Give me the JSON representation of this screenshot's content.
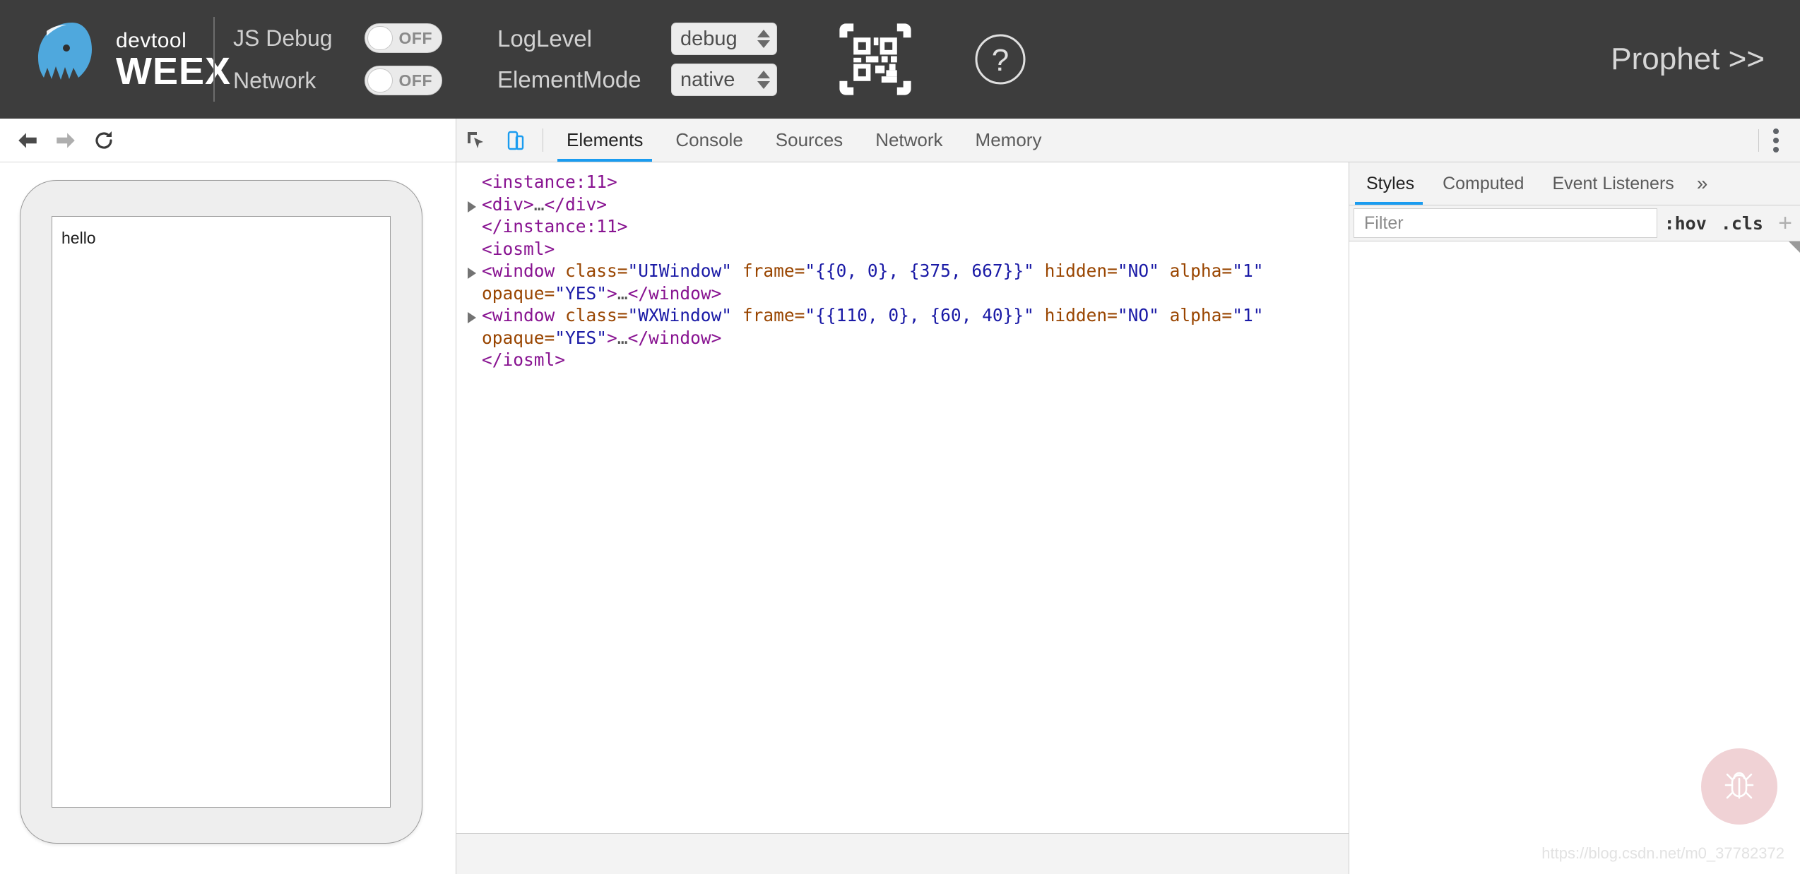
{
  "header": {
    "brand": {
      "devtool": "devtool",
      "weex": "WEEX",
      "logo_icon": "weex-bird-logo-icon"
    },
    "toggles": [
      {
        "label": "JS Debug",
        "state": "OFF",
        "on": false
      },
      {
        "label": "Network",
        "state": "OFF",
        "on": false
      }
    ],
    "selects": [
      {
        "label": "LogLevel",
        "value": "debug"
      },
      {
        "label": "ElementMode",
        "value": "native"
      }
    ],
    "qr_icon": "qr-scan-icon",
    "help_icon": "help-question-icon",
    "prophet_link": "Prophet >>",
    "brand_color": "#4fa8dd",
    "bg_color": "#3d3d3d"
  },
  "preview": {
    "nav": {
      "back_icon": "arrow-back-icon",
      "forward_icon": "arrow-forward-icon",
      "reload_icon": "reload-icon"
    },
    "device_screen_text": "hello"
  },
  "devtools": {
    "toolbar": {
      "inspect_icon": "inspect-cursor-icon",
      "device_icon": "device-toolbar-icon",
      "menu_icon": "kebab-menu-icon",
      "tabs": [
        {
          "label": "Elements",
          "active": true
        },
        {
          "label": "Console",
          "active": false
        },
        {
          "label": "Sources",
          "active": false
        },
        {
          "label": "Network",
          "active": false
        },
        {
          "label": "Memory",
          "active": false
        }
      ],
      "active_tab_color": "#1a9cf0"
    },
    "dom_tree": {
      "lines": [
        {
          "indent": 0,
          "arrow": false,
          "parts": [
            {
              "t": "tag",
              "v": "<instance:11>"
            }
          ]
        },
        {
          "indent": 0,
          "arrow": true,
          "parts": [
            {
              "t": "tag",
              "v": "<div>"
            },
            {
              "t": "dots",
              "v": "…"
            },
            {
              "t": "tag",
              "v": "</div>"
            }
          ]
        },
        {
          "indent": 0,
          "arrow": false,
          "parts": [
            {
              "t": "tag",
              "v": "</instance:11>"
            }
          ]
        },
        {
          "indent": 0,
          "arrow": false,
          "parts": [
            {
              "t": "tag",
              "v": "<iosml>"
            }
          ]
        },
        {
          "indent": 0,
          "arrow": true,
          "parts": [
            {
              "t": "tag",
              "v": "<window "
            },
            {
              "t": "attrn",
              "v": "class"
            },
            {
              "t": "eq",
              "v": "="
            },
            {
              "t": "attrv",
              "v": "\"UIWindow\""
            },
            {
              "t": "attrn",
              "v": " frame"
            },
            {
              "t": "eq",
              "v": "="
            },
            {
              "t": "attrv",
              "v": "\"{{0, 0}, {375, 667}}\""
            },
            {
              "t": "attrn",
              "v": " hidden"
            },
            {
              "t": "eq",
              "v": "="
            },
            {
              "t": "attrv",
              "v": "\"NO\""
            },
            {
              "t": "attrn",
              "v": " alpha"
            },
            {
              "t": "eq",
              "v": "="
            },
            {
              "t": "attrv",
              "v": "\"1\""
            },
            {
              "t": "attrn",
              "v": " opaque"
            },
            {
              "t": "eq",
              "v": "="
            },
            {
              "t": "attrv",
              "v": "\"YES\""
            },
            {
              "t": "tag",
              "v": ">"
            },
            {
              "t": "dots",
              "v": "…"
            },
            {
              "t": "tag",
              "v": "</window>"
            }
          ]
        },
        {
          "indent": 0,
          "arrow": true,
          "parts": [
            {
              "t": "tag",
              "v": "<window "
            },
            {
              "t": "attrn",
              "v": "class"
            },
            {
              "t": "eq",
              "v": "="
            },
            {
              "t": "attrv",
              "v": "\"WXWindow\""
            },
            {
              "t": "attrn",
              "v": " frame"
            },
            {
              "t": "eq",
              "v": "="
            },
            {
              "t": "attrv",
              "v": "\"{{110, 0}, {60, 40}}\""
            },
            {
              "t": "attrn",
              "v": " hidden"
            },
            {
              "t": "eq",
              "v": "="
            },
            {
              "t": "attrv",
              "v": "\"NO\""
            },
            {
              "t": "attrn",
              "v": " alpha"
            },
            {
              "t": "eq",
              "v": "="
            },
            {
              "t": "attrv",
              "v": "\"1\""
            },
            {
              "t": "attrn",
              "v": " opaque"
            },
            {
              "t": "eq",
              "v": "="
            },
            {
              "t": "attrv",
              "v": "\"YES\""
            },
            {
              "t": "tag",
              "v": ">"
            },
            {
              "t": "dots",
              "v": "…"
            },
            {
              "t": "tag",
              "v": "</window>"
            }
          ]
        },
        {
          "indent": 0,
          "arrow": false,
          "parts": [
            {
              "t": "tag",
              "v": "</iosml>"
            }
          ]
        }
      ]
    },
    "styles": {
      "tabs": [
        {
          "label": "Styles",
          "active": true
        },
        {
          "label": "Computed",
          "active": false
        },
        {
          "label": "Event Listeners",
          "active": false
        }
      ],
      "more_icon": "chevron-double-right-icon",
      "filter_placeholder": "Filter",
      "filter_value": "",
      "hov_label": ":hov",
      "cls_label": ".cls",
      "add_label": "+"
    }
  },
  "overlay": {
    "bug_icon": "bug-icon",
    "bug_bg_color": "#f0d2d5",
    "watermark": "https://blog.csdn.net/m0_37782372"
  }
}
